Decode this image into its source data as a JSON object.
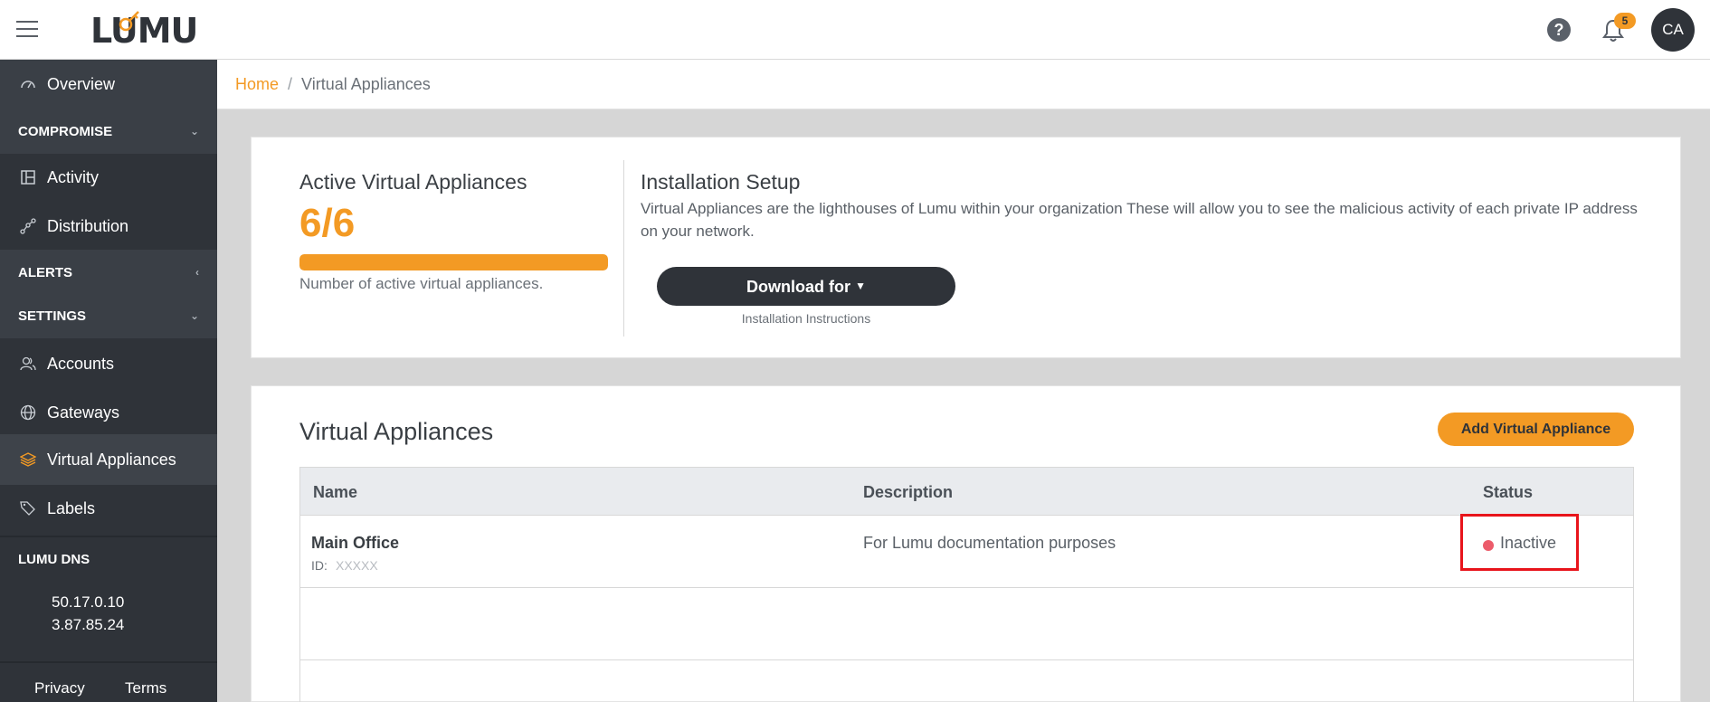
{
  "header": {
    "logo_text": "LUMU",
    "help_icon": "question-circle-icon",
    "notifications_count": "5",
    "avatar_initials": "CA"
  },
  "sidebar": {
    "overview": "Overview",
    "compromise_section": "COMPROMISE",
    "activity": "Activity",
    "distribution": "Distribution",
    "alerts_section": "ALERTS",
    "settings_section": "SETTINGS",
    "accounts": "Accounts",
    "gateways": "Gateways",
    "virtual_appliances": "Virtual Appliances",
    "labels": "Labels",
    "dns_title": "LUMU DNS",
    "dns_ips": [
      "50.17.0.10",
      "3.87.85.24"
    ],
    "footer_privacy": "Privacy",
    "footer_terms": "Terms"
  },
  "breadcrumb": {
    "home": "Home",
    "separator": "/",
    "current": "Virtual Appliances"
  },
  "summary": {
    "title": "Active Virtual Appliances",
    "count": "6/6",
    "active_fraction": 1.0,
    "caption": "Number of active virtual appliances."
  },
  "setup": {
    "title": "Installation Setup",
    "description": "Virtual Appliances are the lighthouses of Lumu within your organization These will allow you to see the malicious activity of each private IP address on your network.",
    "download_label": "Download for",
    "instructions_link": "Installation Instructions"
  },
  "appliances": {
    "title": "Virtual Appliances",
    "add_button": "Add Virtual Appliance",
    "columns": [
      "Name",
      "Description",
      "Status"
    ],
    "rows": [
      {
        "name": "Main Office",
        "id_label": "ID:",
        "id_value": "XXXXX",
        "description": "For Lumu documentation purposes",
        "status": "Inactive"
      }
    ]
  },
  "colors": {
    "accent": "#f39a24",
    "sidebar_bg": "#2f3339",
    "inactive_dot": "#ec5b6a",
    "highlight_box": "#e8141b"
  }
}
